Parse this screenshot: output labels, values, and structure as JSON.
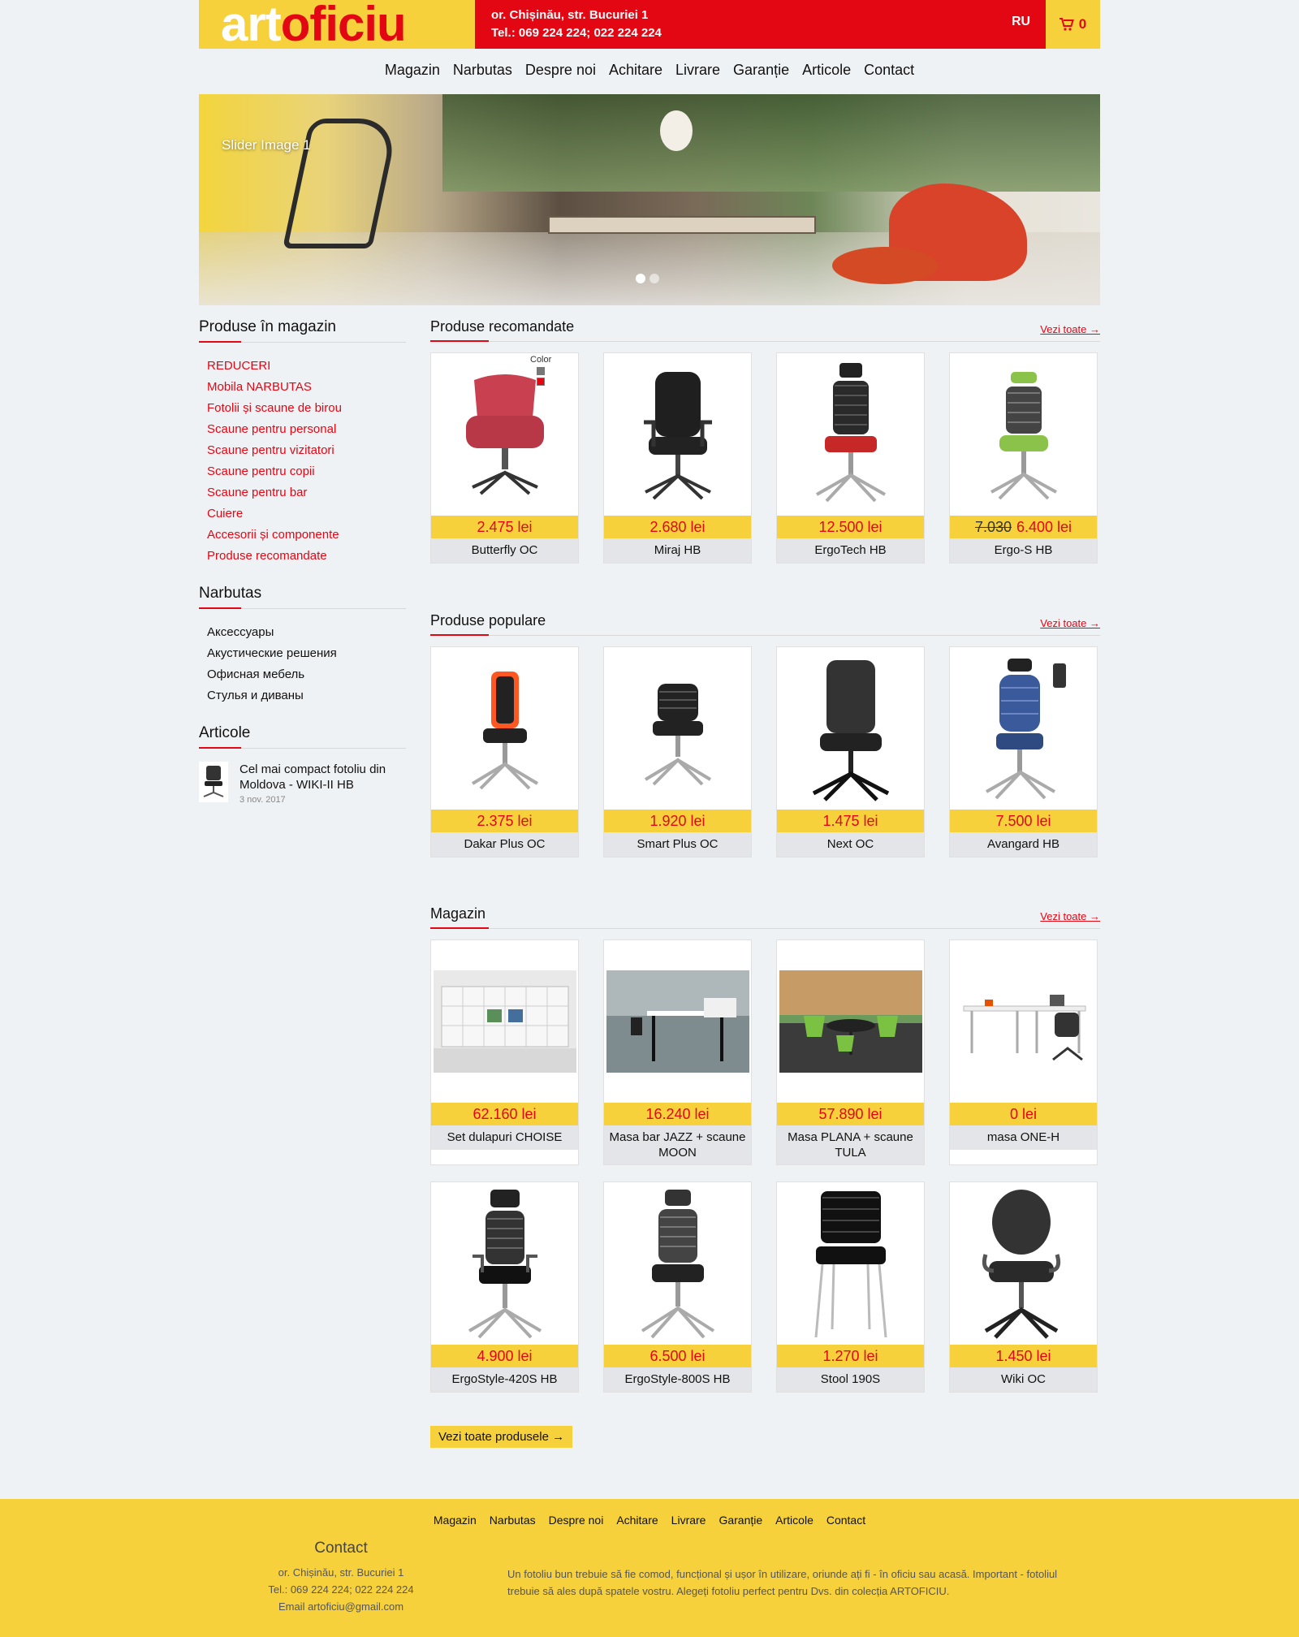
{
  "header": {
    "logo_part1": "art",
    "logo_part2": "oficiu",
    "address": "or. Chișinău, str. Bucuriei 1",
    "phones": "Tel.: 069 224 224; 022 224 224",
    "language": "RU",
    "cart_count": "0"
  },
  "nav": [
    "Magazin",
    "Narbutas",
    "Despre noi",
    "Achitare",
    "Livrare",
    "Garanție",
    "Articole",
    "Contact"
  ],
  "slider": {
    "caption": "Slider Image 1"
  },
  "sidebar": {
    "shop_title": "Produse în magazin",
    "shop_items": [
      "REDUCERI",
      "Mobila NARBUTAS",
      "Fotolii și scaune de birou",
      "Scaune pentru personal",
      "Scaune pentru vizitatori",
      "Scaune pentru copii",
      "Scaune pentru bar",
      "Cuiere",
      "Accesorii și componente",
      "Produse recomandate"
    ],
    "narbutas_title": "Narbutas",
    "narbutas_items": [
      "Аксессуары",
      "Акустические решения",
      "Офисная мебель",
      "Стулья и диваны"
    ],
    "articles_title": "Articole",
    "article": {
      "title": "Cel mai compact fotoliu din Moldova - WIKI-II HB",
      "date": "3 nov. 2017"
    }
  },
  "see_all": "Vezi toate →",
  "recommended": {
    "title": "Produse recomandate",
    "color_label": "Color",
    "products": [
      {
        "price": "2.475 lei",
        "name": "Butterfly OC"
      },
      {
        "price": "2.680 lei",
        "name": "Miraj HB"
      },
      {
        "price": "12.500 lei",
        "name": "ErgoTech HB"
      },
      {
        "old_price": "7.030",
        "price": "6.400 lei",
        "name": "Ergo-S HB"
      }
    ]
  },
  "popular": {
    "title": "Produse populare",
    "products": [
      {
        "price": "2.375 lei",
        "name": "Dakar Plus OC"
      },
      {
        "price": "1.920 lei",
        "name": "Smart Plus OC"
      },
      {
        "price": "1.475 lei",
        "name": "Next OC"
      },
      {
        "price": "7.500 lei",
        "name": "Avangard HB"
      }
    ]
  },
  "shop": {
    "title": "Magazin",
    "products": [
      {
        "price": "62.160 lei",
        "name": "Set dulapuri CHOISE"
      },
      {
        "price": "16.240 lei",
        "name": "Masa bar JAZZ + scaune MOON"
      },
      {
        "price": "57.890 lei",
        "name": "Masa PLANA + scaune TULA"
      },
      {
        "price": "0 lei",
        "name": "masa ONE-H"
      },
      {
        "price": "4.900 lei",
        "name": "ErgoStyle-420S HB"
      },
      {
        "price": "6.500 lei",
        "name": "ErgoStyle-800S HB"
      },
      {
        "price": "1.270 lei",
        "name": "Stool 190S"
      },
      {
        "price": "1.450 lei",
        "name": "Wiki OC"
      }
    ],
    "all_button": "Vezi toate produsele →"
  },
  "footer": {
    "nav": [
      "Magazin",
      "Narbutas",
      "Despre noi",
      "Achitare",
      "Livrare",
      "Garanție",
      "Articole",
      "Contact"
    ],
    "contact_title": "Contact",
    "address": "or. Chișinău, str. Bucuriei 1",
    "phones": "Tel.: 069 224 224; 022 224 224",
    "email": "Email artoficiu@gmail.com",
    "text": "Un fotoliu bun trebuie să fie comod, funcțional și ușor în utilizare, oriunde ați fi - în oficiu sau acasă. Important - fotoliul trebuie să ales după spatele vostru. Alegeți fotoliu perfect pentru Dvs. din colecția ARTOFICIU."
  },
  "colors": {
    "brand_red": "#e30613",
    "brand_yellow": "#f7d13c",
    "background": "#eff2f5"
  }
}
